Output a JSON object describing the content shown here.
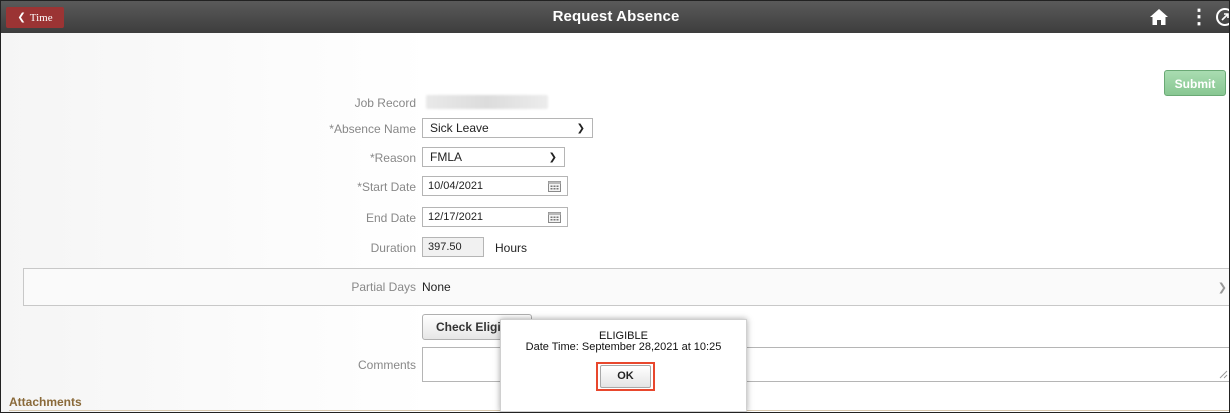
{
  "header": {
    "back_label": "Time",
    "title": "Request Absence",
    "icons": [
      "chevron-left-icon",
      "home-icon",
      "more-vertical-icon",
      "nav-bar-icon"
    ]
  },
  "actions": {
    "submit_label": "Submit"
  },
  "form": {
    "job_record_label": "Job Record",
    "absence_name_label": "*Absence Name",
    "absence_name_value": "Sick Leave",
    "reason_label": "*Reason",
    "reason_value": "FMLA",
    "start_date_label": "*Start Date",
    "start_date_value": "10/04/2021",
    "end_date_label": "End Date",
    "end_date_value": "12/17/2021",
    "duration_label": "Duration",
    "duration_value": "397.50",
    "duration_unit": "Hours",
    "partial_days_label": "Partial Days",
    "partial_days_value": "None",
    "check_eligibility_label": "Check Eligit",
    "comments_label": "Comments",
    "comments_value": ""
  },
  "attachments": {
    "title": "Attachments"
  },
  "dialog": {
    "title": "ELIGIBLE",
    "message": "Date Time: September 28,2021 at 10:25",
    "ok_label": "OK"
  },
  "colors": {
    "header_bg": "#4a4a4a",
    "back_button": "#9b3434",
    "submit_button": "#93cf9d",
    "highlight": "#e8472d",
    "attachments_title": "#8a6a3a"
  }
}
